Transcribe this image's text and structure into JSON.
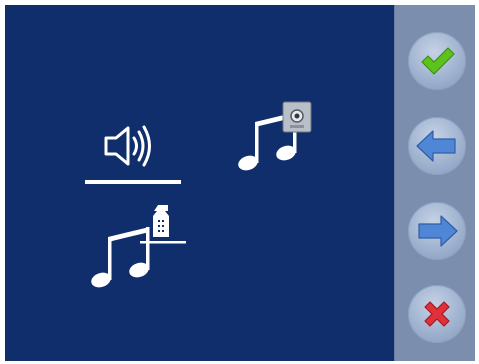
{
  "screen": {
    "background": "#0f2e6b",
    "sidebar_background": "#7b8eae",
    "selected_option": "volume"
  },
  "options": [
    {
      "id": "volume",
      "icon": "speaker-volume-icon",
      "selected": true
    },
    {
      "id": "door-ringtone",
      "icon": "music-note-door-panel-icon",
      "selected": false
    },
    {
      "id": "intercom-ringtone",
      "icon": "music-note-intercom-handset-icon",
      "selected": false
    }
  ],
  "sidebar": {
    "buttons": [
      {
        "id": "confirm",
        "icon": "check-icon",
        "color": "#5cc21c"
      },
      {
        "id": "back",
        "icon": "arrow-left-icon",
        "color": "#4f86d6"
      },
      {
        "id": "forward",
        "icon": "arrow-right-icon",
        "color": "#4f86d6"
      },
      {
        "id": "cancel",
        "icon": "close-icon",
        "color": "#e0303a"
      }
    ]
  }
}
